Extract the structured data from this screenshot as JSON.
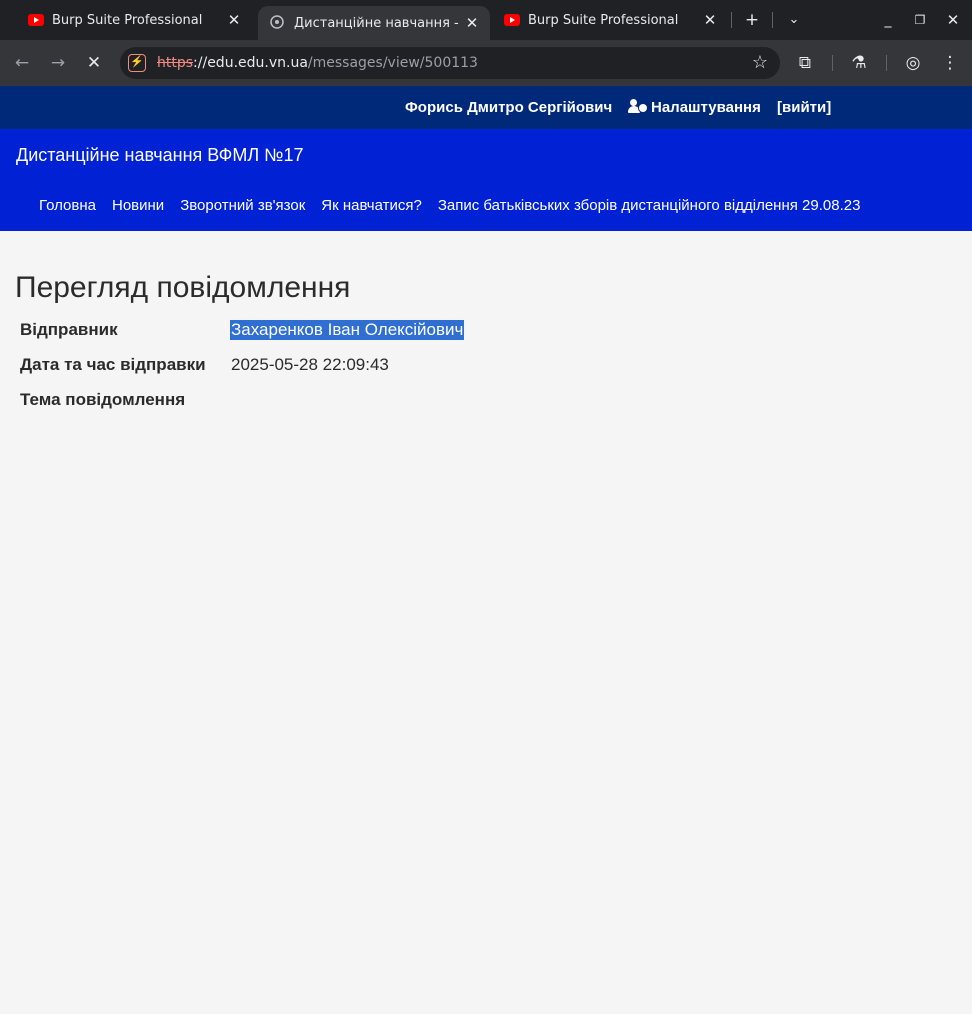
{
  "browser": {
    "tabs": [
      {
        "title": "Burp Suite Professional",
        "icon": "youtube-icon"
      },
      {
        "title": "Дистанційне навчання - Пе",
        "icon": "site-favicon"
      },
      {
        "title": "Burp Suite Professional",
        "icon": "youtube-icon"
      }
    ],
    "url": {
      "scheme": "https",
      "host_path": "://edu.edu.vn.ua",
      "path": "/messages/view/500113"
    }
  },
  "site": {
    "user_name": "Форись Дмитро Сергійович",
    "settings_label": "Налаштування",
    "logout_label": "[вийти]",
    "brand": "Дистанційне навчання ВФМЛ №17",
    "menu": [
      "Головна",
      "Новини",
      "Зворотний зв'язок",
      "Як навчатися?",
      "Запис батьківських зборів дистанційного відділення 29.08.23"
    ]
  },
  "message": {
    "page_title": "Перегляд повідомлення",
    "sender_label": "Відправник",
    "sender_value": "Захаренков Іван Олексійович",
    "date_label": "Дата та час відправки",
    "date_value": "2025-05-28 22:09:43",
    "subject_label": "Тема повідомлення",
    "subject_value": ""
  },
  "colors": {
    "topbar": "#00297a",
    "header": "#0021d4",
    "selection": "#2f6fd1"
  }
}
